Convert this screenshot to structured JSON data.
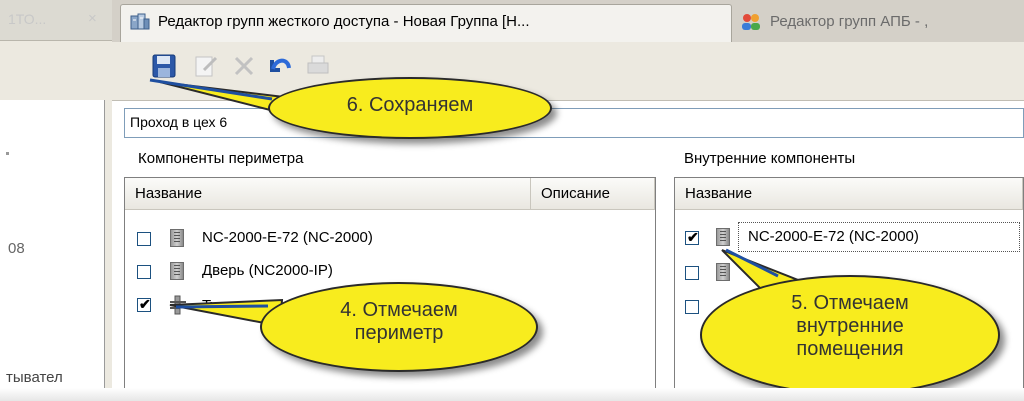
{
  "left_panel": {
    "tab_label": "1ТО...",
    "close_glyph": "×",
    "fragment_number": "08",
    "fragment_word": "тывател"
  },
  "tabs": [
    {
      "label": "Редактор групп жесткого доступа - Новая Группа [Н...",
      "icon": "group-editor-icon",
      "active": true
    },
    {
      "label": "Редактор групп АПБ - ,",
      "icon": "users-group-icon",
      "active": false
    }
  ],
  "toolbar": {
    "buttons": [
      {
        "name": "save-icon",
        "enabled": true
      },
      {
        "name": "edit-icon",
        "enabled": false
      },
      {
        "name": "delete-icon",
        "enabled": false
      },
      {
        "name": "undo-icon",
        "enabled": true
      },
      {
        "name": "print-icon",
        "enabled": false
      }
    ]
  },
  "group_name": {
    "value": "Проход в цех 6"
  },
  "perimeter": {
    "label": "Компоненты периметра",
    "columns": [
      "Название",
      "Описание"
    ],
    "rows": [
      {
        "checked": false,
        "icon": "controller-icon",
        "name": "NC-2000-E-72 (NC-2000)"
      },
      {
        "checked": false,
        "icon": "controller-icon",
        "name": "Дверь (NC2000-IP)"
      },
      {
        "checked": true,
        "icon": "turnstile-icon",
        "name": "Тур"
      }
    ]
  },
  "inner": {
    "label": "Внутренние компоненты",
    "columns": [
      "Название"
    ],
    "rows": [
      {
        "checked": true,
        "icon": "controller-icon",
        "name": "NC-2000-E-72 (NC-2000)",
        "selected": true
      },
      {
        "checked": false,
        "icon": "controller-icon",
        "name": ""
      },
      {
        "checked": false,
        "icon": "controller-icon",
        "name": ""
      }
    ]
  },
  "callouts": [
    {
      "text": "6. Сохраняем"
    },
    {
      "lines": [
        "4. Отмечаем",
        "периметр"
      ]
    },
    {
      "lines": [
        "5. Отмечаем",
        "внутренние",
        "помещения"
      ]
    }
  ],
  "colors": {
    "callout_fill": "#f8ec1e",
    "accent_blue": "#1f4fa0"
  }
}
